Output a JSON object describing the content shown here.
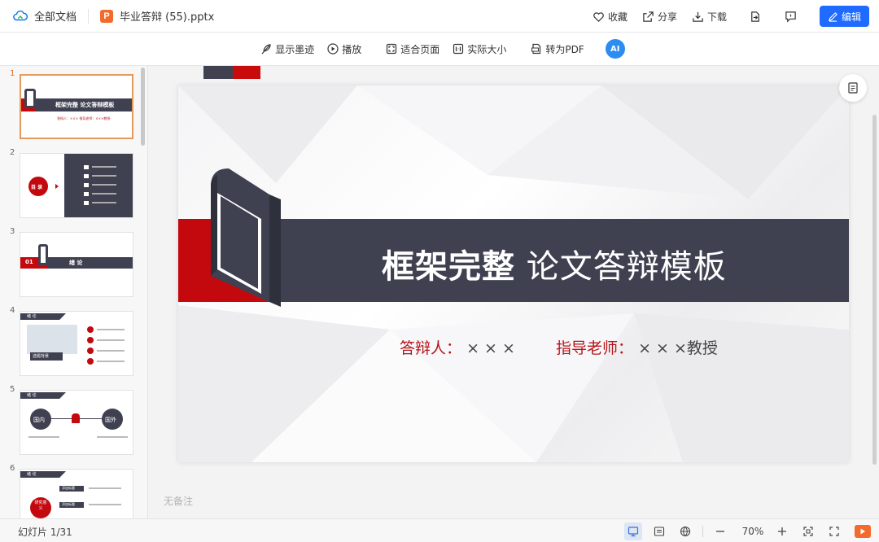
{
  "header": {
    "all_docs": "全部文档",
    "file_badge": "P",
    "file_name": "毕业答辩 (55).pptx",
    "favorite": "收藏",
    "share": "分享",
    "download": "下载",
    "edit": "编辑"
  },
  "toolbar": {
    "show_ink": "显示墨迹",
    "play": "播放",
    "fit_page": "适合页面",
    "actual_size": "实际大小",
    "to_pdf": "转为PDF",
    "ai": "AI"
  },
  "thumbnails": [
    {
      "num": "1",
      "title": "框架完整 论文答辩模板",
      "line": "答辩人：×××   指导老师：×××教授"
    },
    {
      "num": "2",
      "title": "目 录",
      "items": [
        "1",
        "2",
        "3",
        "4",
        "5"
      ]
    },
    {
      "num": "3",
      "tag": "01",
      "title": "绪 论"
    },
    {
      "num": "4",
      "head": "绪 论",
      "box": "选题背景"
    },
    {
      "num": "5",
      "head": "绪 论",
      "left": "国内",
      "right": "国外"
    },
    {
      "num": "6",
      "head": "绪 论",
      "circle": "研究意义",
      "btn1": "添加标题",
      "btn2": "添加标题"
    }
  ],
  "slide": {
    "title_bold": "框架完整",
    "title_light": "论文答辩模板",
    "presenter_label": "答辩人：",
    "presenter_value": "× × ×",
    "advisor_label": "指导老师：",
    "advisor_value": "× × ×教授"
  },
  "notes": "无备注",
  "status": {
    "slide_count": "幻灯片 1/31",
    "zoom": "70%"
  },
  "colors": {
    "accent": "#1f6bff",
    "slide_red": "#c3090e",
    "slide_dark": "#3f4151",
    "ppt_orange": "#f26a2c"
  }
}
